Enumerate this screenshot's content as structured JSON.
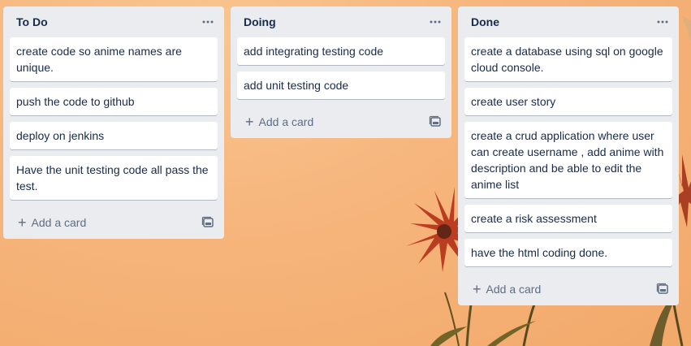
{
  "board": {
    "lists": [
      {
        "title": "To Do",
        "cards": [
          "create code so anime names are unique.",
          "push the code to github",
          "deploy on jenkins",
          "Have the unit testing code all pass the test."
        ],
        "add_label": "Add a card"
      },
      {
        "title": "Doing",
        "cards": [
          "add integrating testing code",
          "add unit testing code"
        ],
        "add_label": "Add a card"
      },
      {
        "title": "Done",
        "cards": [
          "create a database using sql on google cloud console.",
          "create user story",
          "create a crud application where user can create username , add anime with description and be able to edit the anime list",
          "create a risk assessment",
          "have the html coding done."
        ],
        "add_label": "Add a card"
      }
    ],
    "icons": {
      "list_menu": "ellipsis-icon",
      "add_card": "plus-icon",
      "create_from_template": "card-template-icon"
    },
    "colors": {
      "list_background": "#ebecf0",
      "card_background": "#ffffff",
      "text": "#172b4d",
      "muted_text": "#5e6c84"
    }
  }
}
